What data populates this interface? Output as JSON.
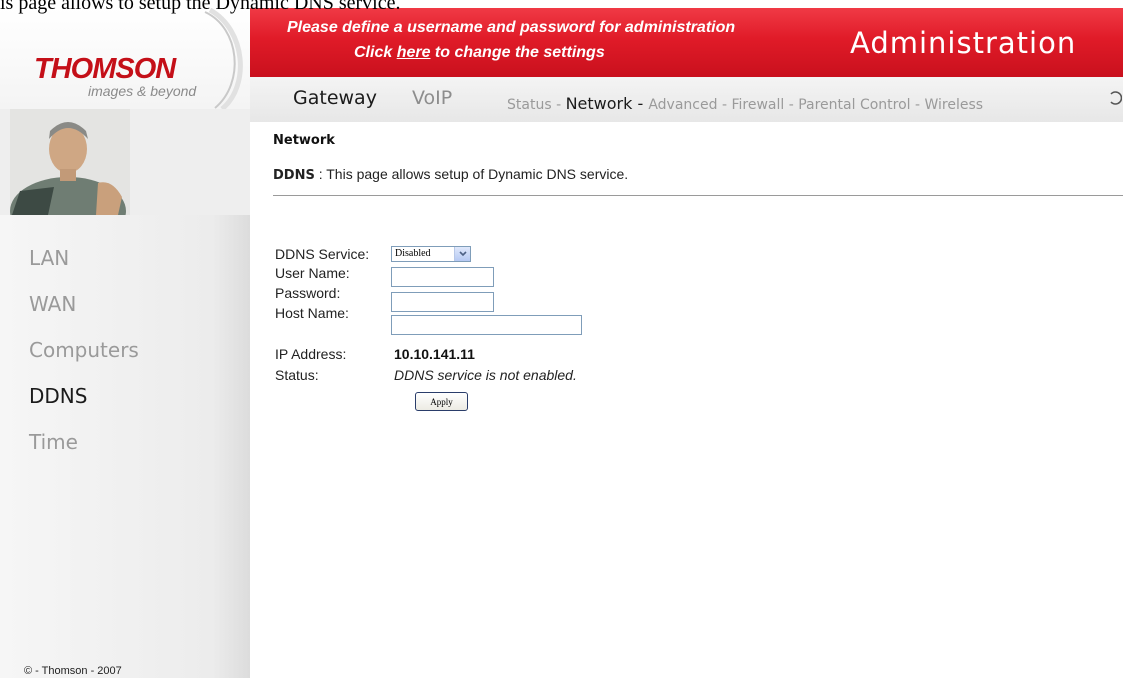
{
  "top_text": "is page allows to setup the Dynamic DNS service.",
  "logo": {
    "brand": "THOMSON",
    "tagline": "images & beyond"
  },
  "sidebar": {
    "items": [
      {
        "label": "LAN",
        "active": false
      },
      {
        "label": "WAN",
        "active": false
      },
      {
        "label": "Computers",
        "active": false
      },
      {
        "label": "DDNS",
        "active": true
      },
      {
        "label": "Time",
        "active": false
      }
    ],
    "copyright": "© - Thomson - 2007"
  },
  "header": {
    "message_line1": "Please define a username and password for administration",
    "message_line2_prefix": "Click ",
    "message_link": "here",
    "message_line2_suffix": " to change the settings",
    "title": "Administration"
  },
  "topnav": {
    "tabs": [
      {
        "label": "Gateway",
        "active": true
      },
      {
        "label": "VoIP",
        "active": false
      }
    ],
    "subnav": [
      {
        "label": "Status",
        "current": false
      },
      {
        "label": "Network",
        "current": true
      },
      {
        "label": "Advanced",
        "current": false
      },
      {
        "label": "Firewall",
        "current": false
      },
      {
        "label": "Parental Control",
        "current": false
      },
      {
        "label": "Wireless",
        "current": false
      }
    ],
    "separator": " - "
  },
  "page": {
    "section_title": "Network",
    "desc_label": "DDNS",
    "desc_text": "  :  This page allows setup of Dynamic DNS service."
  },
  "form": {
    "ddns_service_label": "DDNS Service:",
    "ddns_service_value": "Disabled",
    "user_name_label": "User Name:",
    "user_name_value": "",
    "password_label": "Password:",
    "password_value": "",
    "host_name_label": "Host Name:",
    "host_name_value": "",
    "ip_address_label": "IP Address:",
    "ip_address_value": "10.10.141.11",
    "status_label": "Status:",
    "status_value": "DDNS service is not enabled.",
    "apply_label": "Apply"
  },
  "colors": {
    "brand_red": "#e01b28",
    "nav_active": "#1b1b1b",
    "nav_inactive": "#9a9a9a",
    "sidebar_bg": "#ececec"
  },
  "icons": {
    "select_arrow": "chevron-down-icon",
    "loading": "spinner-icon"
  }
}
